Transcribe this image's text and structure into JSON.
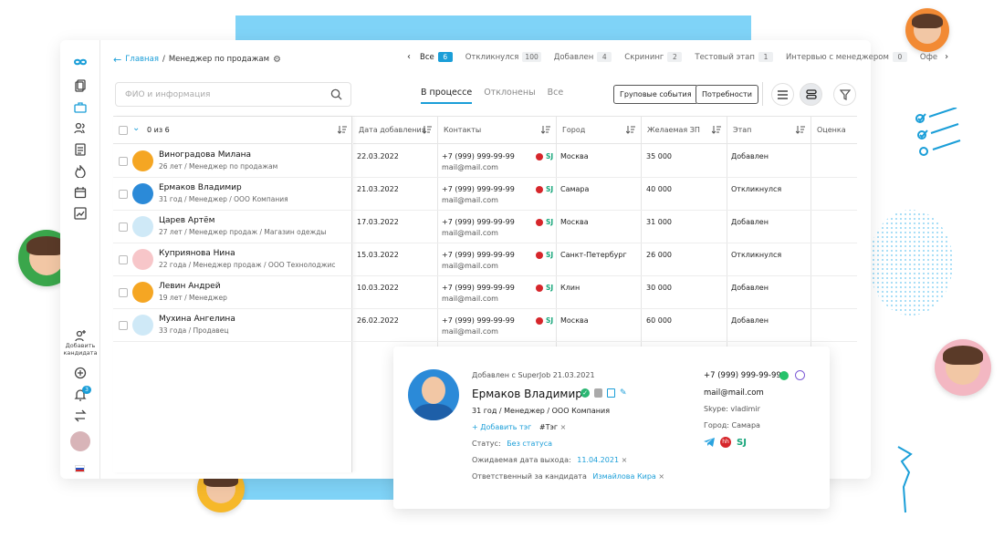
{
  "breadcrumb": {
    "home": "Главная",
    "separator": "/",
    "current": "Менеджер по продажам"
  },
  "stage_filters": [
    {
      "label": "Все",
      "count": "6",
      "active": true
    },
    {
      "label": "Откликнулся",
      "count": "100"
    },
    {
      "label": "Добавлен",
      "count": "4"
    },
    {
      "label": "Скрининг",
      "count": "2"
    },
    {
      "label": "Тестовый этап",
      "count": "1"
    },
    {
      "label": "Интервью с менеджером",
      "count": "0"
    },
    {
      "label": "Офе",
      "count": ""
    }
  ],
  "search": {
    "placeholder": "ФИО и информация"
  },
  "tabs": [
    "В процессе",
    "Отклонены",
    "Все"
  ],
  "buttons": {
    "group_events": "Груповые события",
    "needs": "Потребности"
  },
  "sidebar": {
    "add_candidate": "Добавить кандидата",
    "notifications_badge": "3"
  },
  "table": {
    "selection": "0 из 6",
    "headers": [
      "Дата добавления",
      "Контакты",
      "Город",
      "Желаемая ЗП",
      "Этап",
      "Оценка"
    ],
    "rows": [
      {
        "name": "Виноградова Милана",
        "info": "26 лет / Менеджер по продажам",
        "date": "22.03.2022",
        "phone": "+7 (999) 999-99-99",
        "email": "mail@mail.com",
        "city": "Москва",
        "salary": "35 000",
        "stage": "Добавлен"
      },
      {
        "name": "Ермаков Владимир",
        "info": "31 год / Менеджер / ООО Компания",
        "date": "21.03.2022",
        "phone": "+7 (999) 999-99-99",
        "email": "mail@mail.com",
        "city": "Самара",
        "salary": "40 000",
        "stage": "Откликнулся"
      },
      {
        "name": "Царев Артём",
        "info": "27 лет / Менеджер продаж / Магазин одежды",
        "date": "17.03.2022",
        "phone": "+7 (999) 999-99-99",
        "email": "mail@mail.com",
        "city": "Москва",
        "salary": "31 000",
        "stage": "Добавлен"
      },
      {
        "name": "Куприянова Нина",
        "info": "22 года / Менеджер продаж / ООО Технолоджис",
        "date": "15.03.2022",
        "phone": "+7 (999) 999-99-99",
        "email": "mail@mail.com",
        "city": "Санкт-Петербург",
        "salary": "26 000",
        "stage": "Откликнулся"
      },
      {
        "name": "Левин Андрей",
        "info": "19 лет / Менеджер",
        "date": "10.03.2022",
        "phone": "+7 (999) 999-99-99",
        "email": "mail@mail.com",
        "city": "Клин",
        "salary": "30 000",
        "stage": "Добавлен"
      },
      {
        "name": "Мухина Ангелина",
        "info": "33 года / Продавец",
        "date": "26.02.2022",
        "phone": "+7 (999) 999-99-99",
        "email": "mail@mail.com",
        "city": "Москва",
        "salary": "60 000",
        "stage": "Добавлен"
      }
    ]
  },
  "card": {
    "added": "Добавлен с SuperJob 21.03.2021",
    "name": "Ермаков Владимир",
    "info": "31 год / Менеджер / ООО Компания",
    "add_tag": "+ Добавить тэг",
    "tag": "#Тэг",
    "status_label": "Статус:",
    "status_value": "Без статуса",
    "exit_label": "Ожидаемая дата выхода:",
    "exit_value": "11.04.2021",
    "resp_label": "Ответственный за кандидата",
    "resp_value": "Измайлова Кира",
    "phone": "+7 (999) 999-99-99",
    "email": "mail@mail.com",
    "skype": "Skype: vladimir",
    "city": "Город: Самара",
    "sj": "SJ"
  },
  "colors": {
    "accent": "#1a9ed8",
    "deco": "#7fd3f7",
    "hh": "#d6262b",
    "sj": "#16a57a"
  },
  "avatar_colors": [
    "#f5a623",
    "#2b8ad8",
    "#cfe9f7",
    "#f7c6c9",
    "#f5a623",
    "#cfe9f7"
  ]
}
